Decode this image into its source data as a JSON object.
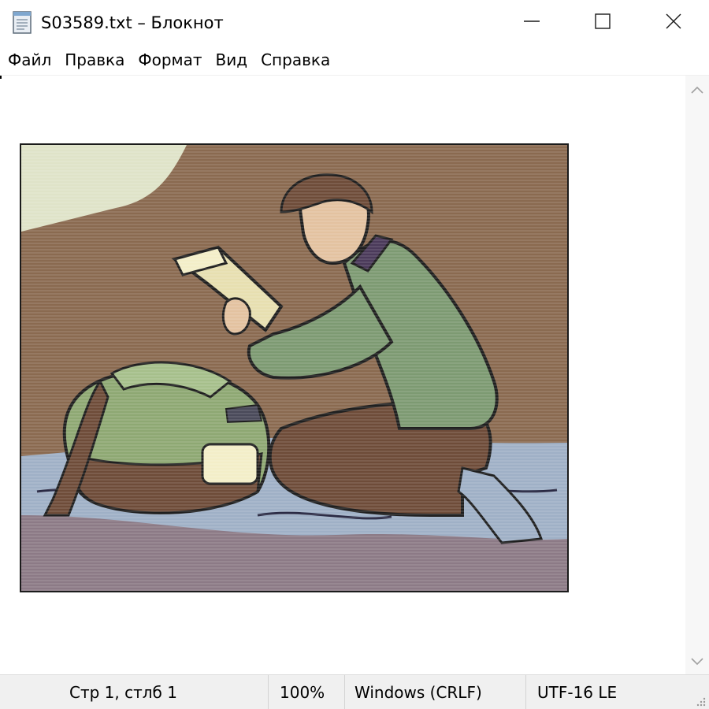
{
  "window": {
    "title": "S03589.txt – Блокнот",
    "app_icon": "notepad-icon",
    "controls": {
      "minimize_icon": "minimize-icon",
      "maximize_icon": "maximize-icon",
      "close_icon": "close-icon"
    }
  },
  "menu": {
    "items": [
      {
        "label": "Файл"
      },
      {
        "label": "Правка"
      },
      {
        "label": "Формат"
      },
      {
        "label": "Вид"
      },
      {
        "label": "Справка"
      }
    ]
  },
  "editor": {
    "content_icon": "ascii-art-picture",
    "colors": {
      "wall": "#8a6a50",
      "floor": "#9fb0c6",
      "shirt": "#7d9a72",
      "pants": "#6e4c39",
      "backpack": "#8ea873",
      "book": "#e7dfb0",
      "skin": "#e3c2a0",
      "lamp_light": "#dfe3c8"
    }
  },
  "scrollbar": {
    "up_icon": "chevron-up-icon",
    "down_icon": "chevron-down-icon"
  },
  "status": {
    "position": "Стр 1, стлб 1",
    "zoom": "100%",
    "line_ending": "Windows (CRLF)",
    "encoding": "UTF-16 LE",
    "grip_icon": "resize-grip-icon"
  }
}
